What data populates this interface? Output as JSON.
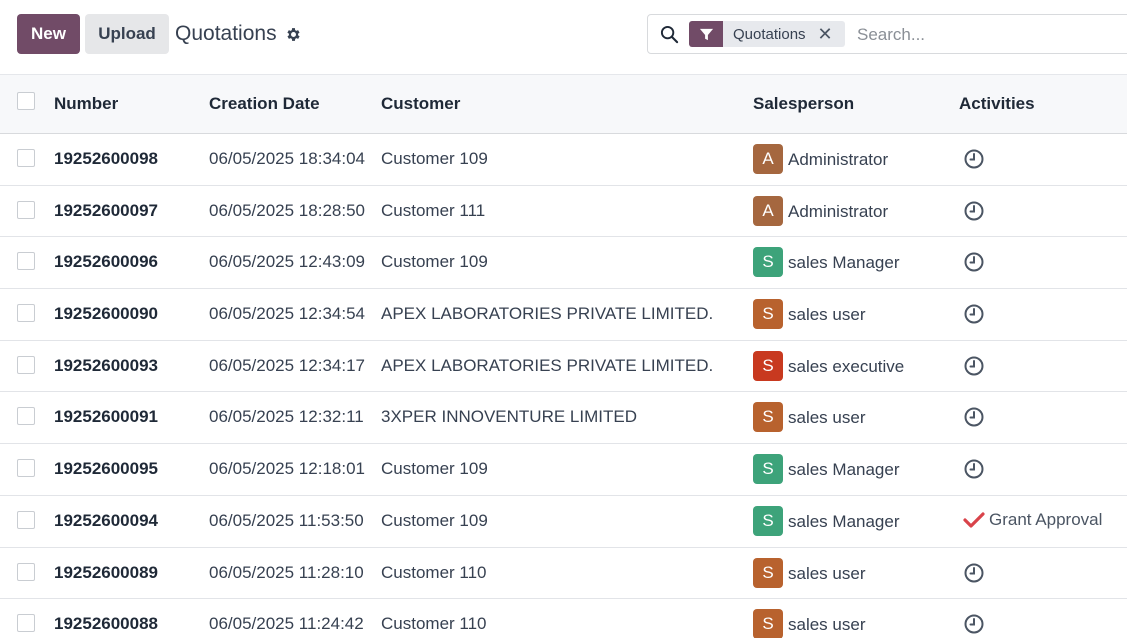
{
  "control_panel": {
    "new_label": "New",
    "upload_label": "Upload",
    "title": "Quotations"
  },
  "search": {
    "facet_label": "Quotations",
    "placeholder": "Search..."
  },
  "table": {
    "columns": {
      "number": "Number",
      "creation_date": "Creation Date",
      "customer": "Customer",
      "salesperson": "Salesperson",
      "activities": "Activities"
    },
    "rows": [
      {
        "number": "19252600098",
        "date": "06/05/2025 18:34:04",
        "customer": "Customer 109",
        "avatar": "A",
        "avatar_color": "#a5673f",
        "salesperson": "Administrator",
        "activity": "clock"
      },
      {
        "number": "19252600097",
        "date": "06/05/2025 18:28:50",
        "customer": "Customer 111",
        "avatar": "A",
        "avatar_color": "#a5673f",
        "salesperson": "Administrator",
        "activity": "clock"
      },
      {
        "number": "19252600096",
        "date": "06/05/2025 12:43:09",
        "customer": "Customer 109",
        "avatar": "S",
        "avatar_color": "#3da37a",
        "salesperson": "sales Manager",
        "activity": "clock"
      },
      {
        "number": "19252600090",
        "date": "06/05/2025 12:34:54",
        "customer": "APEX LABORATORIES PRIVATE LIMITED.",
        "avatar": "S",
        "avatar_color": "#b8622e",
        "salesperson": "sales user",
        "activity": "clock"
      },
      {
        "number": "19252600093",
        "date": "06/05/2025 12:34:17",
        "customer": "APEX LABORATORIES PRIVATE LIMITED.",
        "avatar": "S",
        "avatar_color": "#c8391f",
        "salesperson": "sales executive",
        "activity": "clock"
      },
      {
        "number": "19252600091",
        "date": "06/05/2025 12:32:11",
        "customer": "3XPER INNOVENTURE LIMITED",
        "avatar": "S",
        "avatar_color": "#b8622e",
        "salesperson": "sales user",
        "activity": "clock"
      },
      {
        "number": "19252600095",
        "date": "06/05/2025 12:18:01",
        "customer": "Customer 109",
        "avatar": "S",
        "avatar_color": "#3da37a",
        "salesperson": "sales Manager",
        "activity": "clock"
      },
      {
        "number": "19252600094",
        "date": "06/05/2025 11:53:50",
        "customer": "Customer 109",
        "avatar": "S",
        "avatar_color": "#3da37a",
        "salesperson": "sales Manager",
        "activity": "grant",
        "activity_label": "Grant Approval"
      },
      {
        "number": "19252600089",
        "date": "06/05/2025 11:28:10",
        "customer": "Customer 110",
        "avatar": "S",
        "avatar_color": "#b8622e",
        "salesperson": "sales user",
        "activity": "clock"
      },
      {
        "number": "19252600088",
        "date": "06/05/2025 11:24:42",
        "customer": "Customer 110",
        "avatar": "S",
        "avatar_color": "#b8622e",
        "salesperson": "sales user",
        "activity": "clock"
      }
    ]
  },
  "colors": {
    "primary": "#714b67",
    "approval_check": "#d9434a"
  }
}
